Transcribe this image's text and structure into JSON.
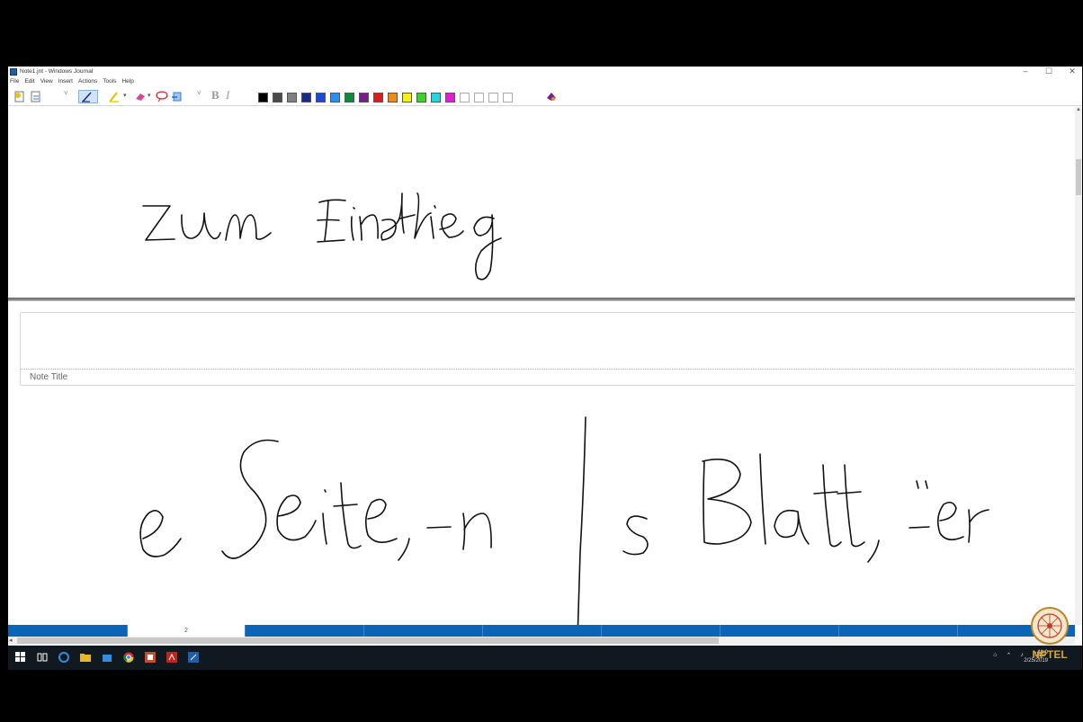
{
  "window": {
    "title": "Note1.jnt - Windows Journal",
    "minimize": "–",
    "maximize": "☐",
    "close": "✕"
  },
  "menu": [
    "File",
    "Edit",
    "View",
    "Insert",
    "Actions",
    "Tools",
    "Help"
  ],
  "toolbar": {
    "bold": "B",
    "italic": "I",
    "colors": [
      "#000000",
      "#4a4a4a",
      "#808080",
      "#1b2a8a",
      "#1a4ad6",
      "#2a8ef0",
      "#0f8a3a",
      "#7a1d8c",
      "#d81e1e",
      "#f08a1a",
      "#f5ef1a",
      "#3ed12a",
      "#22d8e0",
      "#e01ed8",
      "#ffffff",
      "#ffffff",
      "#ffffff",
      "#ffffff"
    ]
  },
  "canvas": {
    "handwriting_top": "zum Einstieg",
    "handwriting_main_left": "e Seite, -n",
    "handwriting_main_right": "s Blatt, ̈er",
    "note_title_placeholder": "Note Title"
  },
  "pagebar": {
    "active_page_label": "2"
  },
  "taskbar": {
    "tray_lang": "ENG",
    "clock_time": "11:0",
    "clock_date": "2/25/2019"
  },
  "logo": {
    "text": "NPTEL"
  }
}
